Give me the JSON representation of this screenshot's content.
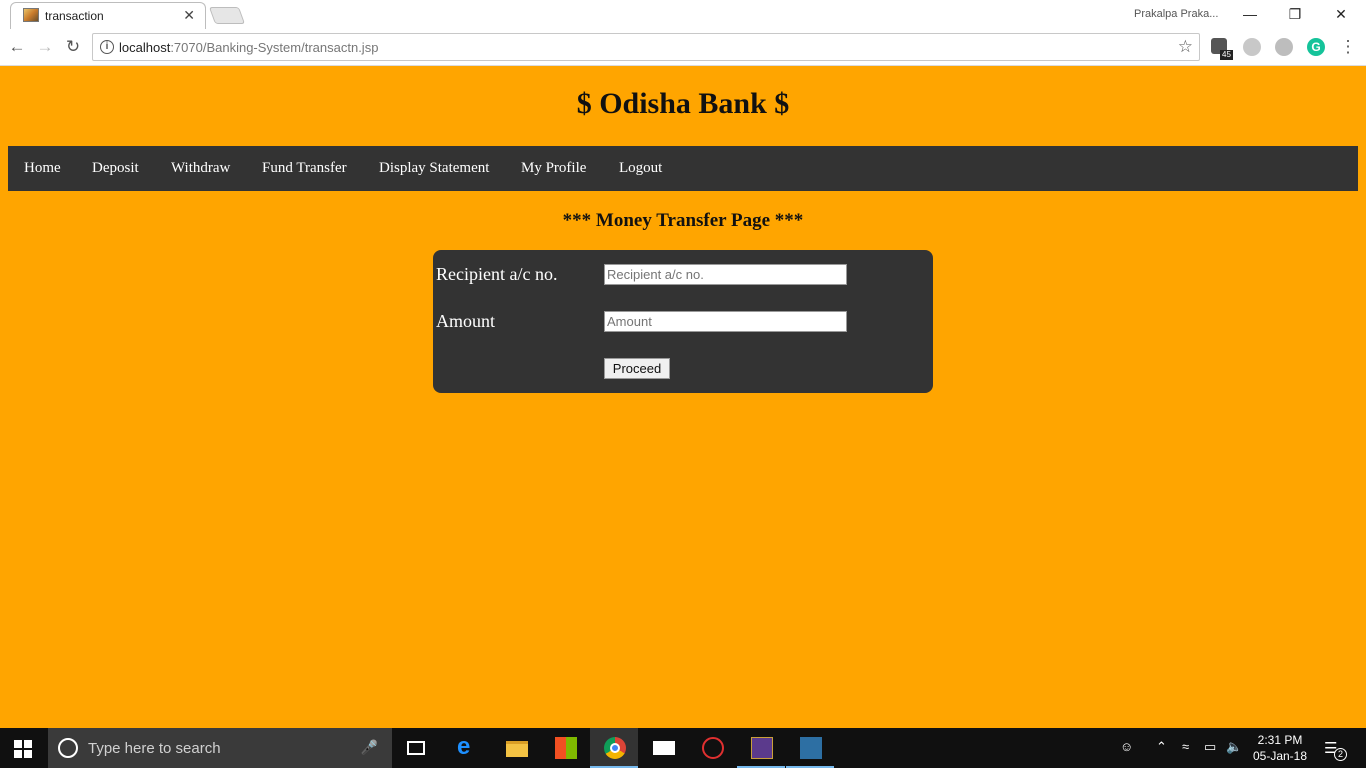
{
  "browser": {
    "tab_title": "transaction",
    "tab_close": "✕",
    "profile_name": "Prakalpa Praka...",
    "window_controls": {
      "minimize": "—",
      "restore": "❐",
      "close": "✕"
    },
    "url_host": "localhost",
    "url_rest": ":7070/Banking-System/transactn.jsp",
    "extension_badge": "45",
    "icons": {
      "back": "back-arrow-icon",
      "forward": "forward-arrow-icon",
      "reload": "reload-icon",
      "info": "info-icon",
      "star": "star-icon",
      "menu": "kebab-menu-icon"
    }
  },
  "page": {
    "bank_title": "$ Odisha Bank $",
    "nav": [
      "Home",
      "Deposit",
      "Withdraw",
      "Fund Transfer",
      "Display Statement",
      "My Profile",
      "Logout"
    ],
    "heading": "*** Money Transfer Page ***",
    "form": {
      "recipient_label": "Recipient a/c no.",
      "recipient_placeholder": "Recipient a/c no.",
      "amount_label": "Amount",
      "amount_placeholder": "Amount",
      "submit_label": "Proceed"
    },
    "colors": {
      "background": "#ffa500",
      "nav_bg": "#333333",
      "form_bg": "#333333"
    }
  },
  "taskbar": {
    "search_placeholder": "Type here to search",
    "time": "2:31 PM",
    "date": "05-Jan-18",
    "notification_count": "2"
  }
}
